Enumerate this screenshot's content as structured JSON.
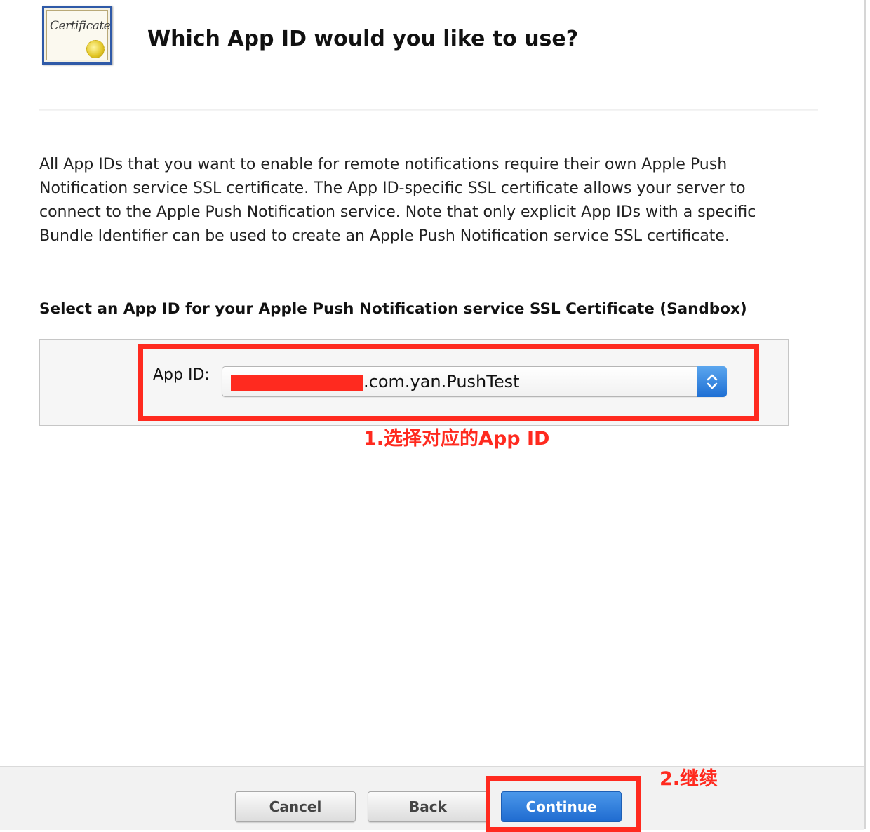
{
  "header": {
    "certificate_icon_text": "Certificate",
    "title": "Which App ID would you like to use?"
  },
  "description": "All App IDs that you want to enable for remote notifications require their own Apple Push Notification service SSL certificate. The App ID-specific SSL certificate allows your server to connect to the Apple Push Notification service. Note that only explicit App IDs with a specific Bundle Identifier can be used to create an Apple Push Notification service SSL certificate.",
  "section": {
    "heading": "Select an App ID for your Apple Push Notification service SSL Certificate (Sandbox)",
    "app_id_label": "App ID:",
    "app_id_value": ".com.yan.PushTest",
    "select_arrow_icon": "updown-chevron-icon"
  },
  "annotations": {
    "step1": "1.选择对应的App ID",
    "step2": "2.继续",
    "color": "#ff2a1f"
  },
  "footer": {
    "cancel_label": "Cancel",
    "back_label": "Back",
    "continue_label": "Continue",
    "accent_color": "#1f6bd0"
  }
}
